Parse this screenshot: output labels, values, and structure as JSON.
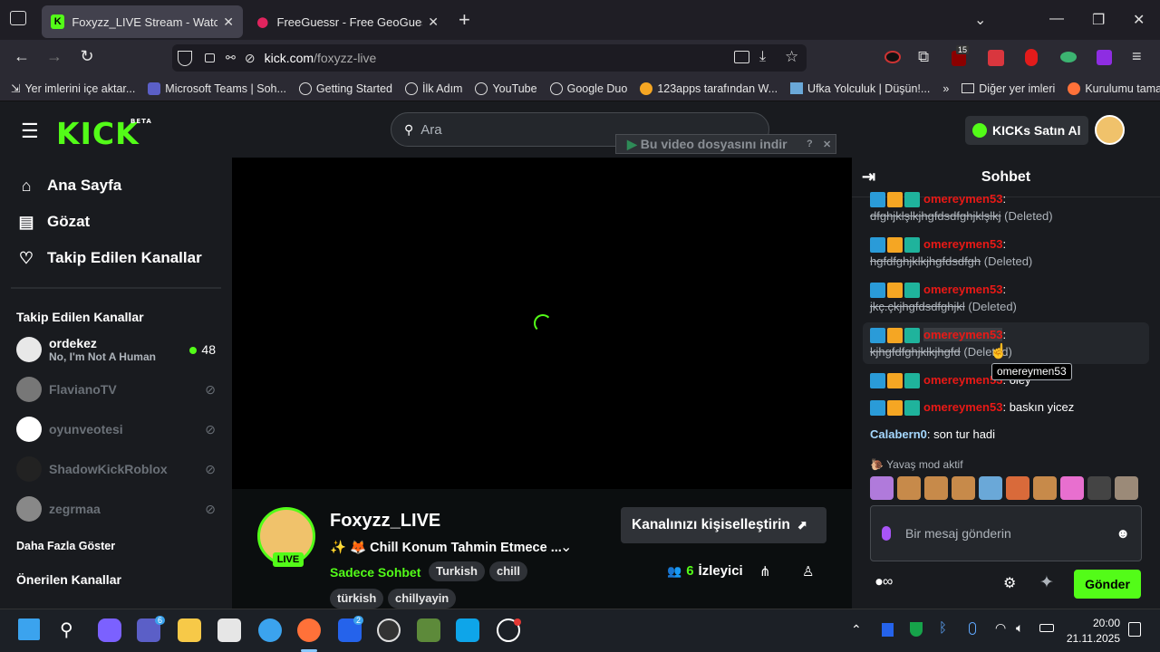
{
  "browser": {
    "tabs": [
      {
        "title": "Foxyzz_LIVE Stream - Watch Live",
        "active": true
      },
      {
        "title": "FreeGuessr - Free GeoGuessr Al",
        "active": false
      }
    ],
    "url_host": "kick.com",
    "url_path": "/foxyzz-live",
    "extension_badge": "15",
    "bookmarks": [
      "Yer imlerini içe aktar...",
      "Microsoft Teams | Soh...",
      "Getting Started",
      "İlk Adım",
      "YouTube",
      "Google Duo",
      "123apps tarafından W...",
      "Ufka Yolculuk | Düşün!...",
      "Diğer yer imleri",
      "Kurulumu tamamla"
    ]
  },
  "header": {
    "logo": "KICK",
    "logo_tag": "BETA",
    "search_placeholder": "Ara",
    "download_bar": "Bu video dosyasını indir",
    "kicks_button": "KICKs Satın Al"
  },
  "sidebar": {
    "nav": [
      {
        "label": "Ana Sayfa",
        "icon": "home-icon"
      },
      {
        "label": "Gözat",
        "icon": "browse-icon"
      },
      {
        "label": "Takip Edilen Kanallar",
        "icon": "heart-icon"
      }
    ],
    "following_title": "Takip Edilen Kanallar",
    "channels": [
      {
        "name": "ordekez",
        "subtitle": "No, I'm Not A Human",
        "viewers": "48",
        "live": true
      },
      {
        "name": "FlavianoTV",
        "live": false
      },
      {
        "name": "oyunveotesi",
        "live": false
      },
      {
        "name": "ShadowKickRoblox",
        "live": false
      },
      {
        "name": "zegrmaa",
        "live": false
      }
    ],
    "show_more": "Daha Fazla Göster",
    "recommended_title": "Önerilen Kanallar"
  },
  "stream": {
    "channel_name": "Foxyzz_LIVE",
    "live_badge": "LIVE",
    "title": "✨ 🦊 Chill Konum Tahmin Etmece ...",
    "category": "Sadece Sohbet",
    "tags": [
      "Turkish",
      "chill",
      "türkish",
      "chillyayin"
    ],
    "customize_button": "Kanalınızı kişiselleştirin",
    "viewer_count": "6",
    "viewer_label": "İzleyici"
  },
  "chat": {
    "title": "Sohbet",
    "messages": [
      {
        "user": "omereymen53",
        "text": "dfghjklşlkjhgfdsdfghjklşlkj",
        "deleted": "(Deleted)"
      },
      {
        "user": "omereymen53",
        "text": "hgfdfghjklkjhgfdsdfgh",
        "deleted": "(Deleted)"
      },
      {
        "user": "omereymen53",
        "text": "jkç.çkjhgfdsdfghjkl",
        "deleted": "(Deleted)"
      },
      {
        "user": "omereymen53",
        "text": "kjhgfdfghjklkjhgfd",
        "deleted": "(Deleted)"
      },
      {
        "user": "omereymen53",
        "text": "oley"
      },
      {
        "user": "omereymen53",
        "text": "baskın yicez"
      },
      {
        "user": "Calabern0",
        "text": "son tur hadi"
      }
    ],
    "tooltip": "omereymen53",
    "slow_mode": "Yavaş mod aktif",
    "input_placeholder": "Bir mesaj gönderin",
    "send_button": "Gönder",
    "username_color": "#e91916",
    "other_user_color": "#a5d8ff"
  },
  "taskbar": {
    "time": "20:00",
    "date": "21.11.2025",
    "teams_badge": "6",
    "l_badge": "2"
  },
  "colors": {
    "accent": "#53fc18",
    "background": "#0b0e0f",
    "panel": "#191b1f"
  }
}
